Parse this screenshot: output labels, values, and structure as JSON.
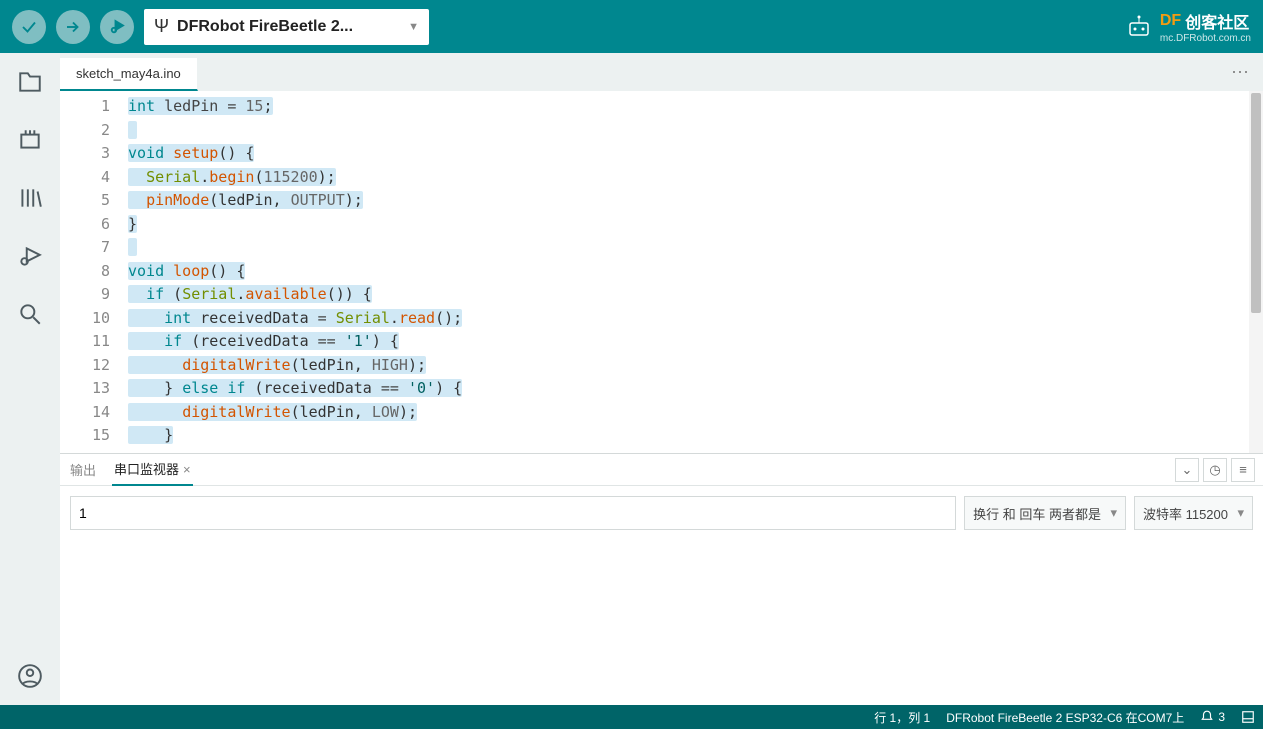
{
  "toolbar": {
    "board_label": "DFRobot FireBeetle 2..."
  },
  "brand": {
    "name_left": "DF",
    "name_right": "创客社区",
    "sub": "mc.DFRobot.com.cn"
  },
  "tab": {
    "filename": "sketch_may4a.ino"
  },
  "code": {
    "lines": [
      {
        "n": 1,
        "html": "<span class='sel-bg'><span class='kw'>int</span> <span class='pl'>ledPin</span> <span class='op'>=</span> <span class='num'>15</span>;</span>"
      },
      {
        "n": 2,
        "html": "<span class='sel-bg'> </span>"
      },
      {
        "n": 3,
        "html": "<span class='sel-bg'><span class='kw'>void</span> <span class='fn'>setup</span>() {</span>"
      },
      {
        "n": 4,
        "html": "<span class='sel-bg'>  <span class='obj'>Serial</span>.<span class='fn'>begin</span>(<span class='num'>115200</span>);</span>"
      },
      {
        "n": 5,
        "html": "<span class='sel-bg'>  <span class='fn'>pinMode</span>(ledPin, <span class='num'>OUTPUT</span>);</span>"
      },
      {
        "n": 6,
        "html": "<span class='sel-bg'>}</span>"
      },
      {
        "n": 7,
        "html": "<span class='sel-bg'> </span>"
      },
      {
        "n": 8,
        "html": "<span class='sel-bg'><span class='kw'>void</span> <span class='fn'>loop</span>() {</span>"
      },
      {
        "n": 9,
        "html": "<span class='sel-bg'>  <span class='kw'>if</span> (<span class='obj'>Serial</span>.<span class='fn'>available</span>()) {</span>"
      },
      {
        "n": 10,
        "html": "<span class='sel-bg'>    <span class='kw'>int</span> receivedData <span class='op'>=</span> <span class='obj'>Serial</span>.<span class='fn'>read</span>();</span>"
      },
      {
        "n": 11,
        "html": "<span class='sel-bg'>    <span class='kw'>if</span> (receivedData <span class='op'>==</span> <span class='str'>'1'</span>) {</span>"
      },
      {
        "n": 12,
        "html": "<span class='sel-bg'>      <span class='fn'>digitalWrite</span>(ledPin, <span class='num'>HIGH</span>);</span>"
      },
      {
        "n": 13,
        "html": "<span class='sel-bg'>    } <span class='kw'>else</span> <span class='kw'>if</span> (receivedData <span class='op'>==</span> <span class='str'>'0'</span>) {</span>"
      },
      {
        "n": 14,
        "html": "<span class='sel-bg'>      <span class='fn'>digitalWrite</span>(ledPin, <span class='num'>LOW</span>);</span>"
      },
      {
        "n": 15,
        "html": "<span class='sel-bg'>    }</span>"
      }
    ]
  },
  "panel": {
    "tab_output": "输出",
    "tab_serial": "串口监视器",
    "input_value": "1",
    "line_ending": "换行 和 回车 两者都是",
    "baud": "波特率 115200"
  },
  "status": {
    "pos": "行 1，列 1",
    "board": "DFRobot FireBeetle 2 ESP32-C6 在COM7上",
    "notif_count": "3"
  }
}
